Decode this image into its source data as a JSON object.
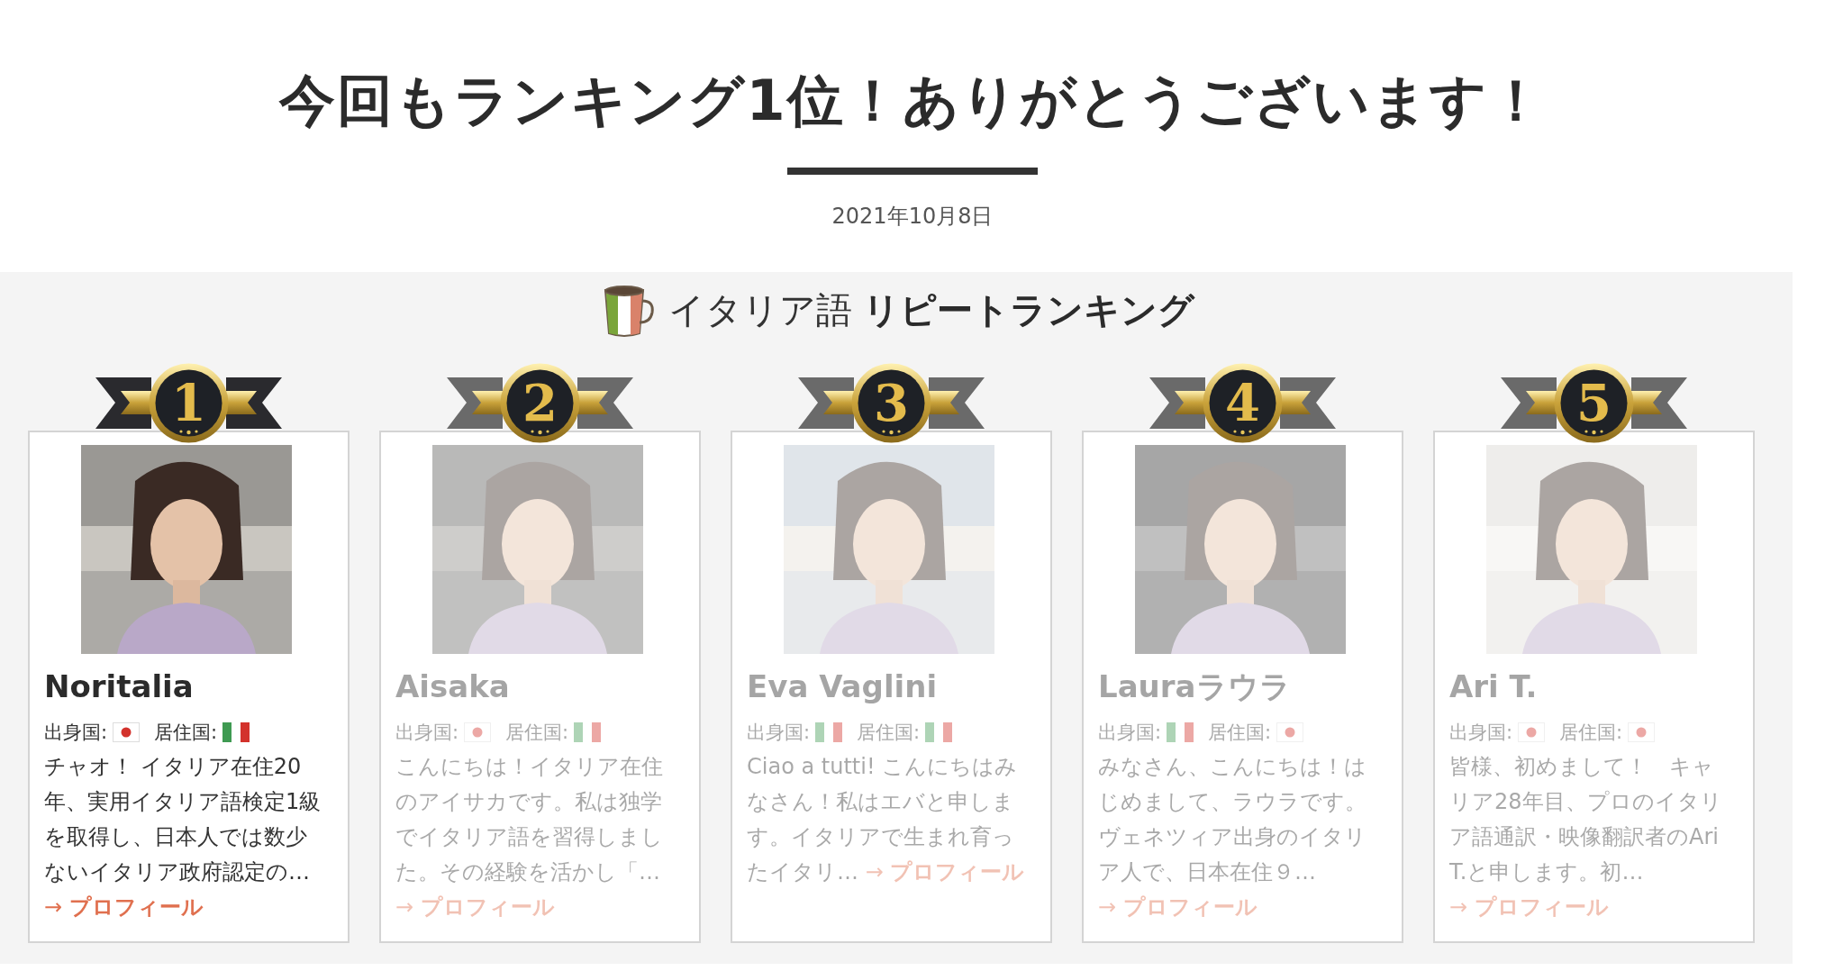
{
  "title": "今回もランキング1位！ありがとうございます！",
  "date": "2021年10月8日",
  "ranking": {
    "language": "イタリア語",
    "heading": "リピートランキング",
    "teachers": [
      {
        "rank": "1",
        "name": "Noritalia",
        "origin": {
          "label": "出身国:",
          "kind": "japan"
        },
        "residence": {
          "label": "居住国:",
          "kind": "italy"
        },
        "description": "チャオ！ イタリア在住20年、実用イタリア語検定1級を取得し、日本人では数少ないイタリア政府認定の…",
        "link": "→ **プロフィール**",
        "selected": true
      },
      {
        "rank": "2",
        "name": "Aisaka",
        "origin": {
          "label": "出身国:",
          "kind": "japan"
        },
        "residence": {
          "label": "居住国:",
          "kind": "italy"
        },
        "description": "こんにちは！イタリア在住のアイサカです。私は独学でイタリア語を習得しました。その経験を活かし「…",
        "link": "→ **プロフィール**",
        "selected": false
      },
      {
        "rank": "3",
        "name": "Eva Vaglini",
        "origin": {
          "label": "出身国:",
          "kind": "italy"
        },
        "residence": {
          "label": "居住国:",
          "kind": "italy"
        },
        "description": "Ciao a tutti! こんにちはみなさん！私はエバと申します。イタリアで生まれ育ったイタリ…",
        "link": "→ **プロフィール**",
        "selected": false
      },
      {
        "rank": "4",
        "name": "Lauraラウラ",
        "origin": {
          "label": "出身国:",
          "kind": "italy"
        },
        "residence": {
          "label": "居住国:",
          "kind": "japan"
        },
        "description": "みなさん、こんにちは！はじめまして、ラウラです。ヴェネツィア出身のイタリア人で、日本在住９…",
        "link": "→ **プロフィール**",
        "selected": false
      },
      {
        "rank": "5",
        "name": "Ari T.",
        "origin": {
          "label": "出身国:",
          "kind": "japan"
        },
        "residence": {
          "label": "居住国:",
          "kind": "japan"
        },
        "description": "皆様、初めまして！　キャリア28年目、プロのイタリア語通訳・映像翻訳者のAri T.と申します。初…",
        "link": "→ **プロフィール**",
        "selected": false
      }
    ]
  }
}
